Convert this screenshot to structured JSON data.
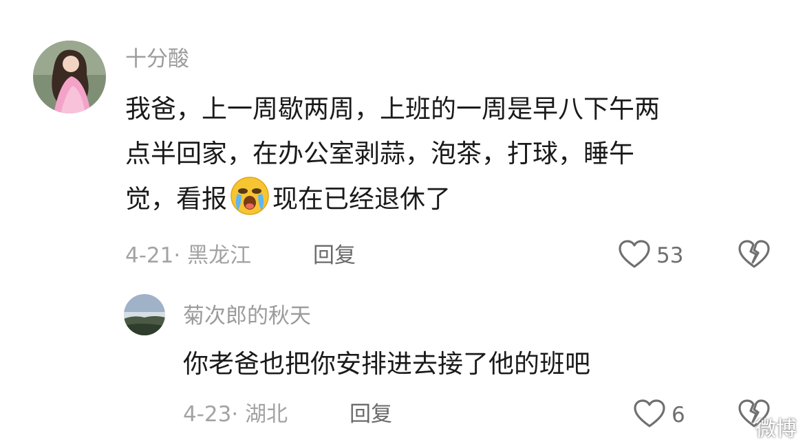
{
  "comments": [
    {
      "username": "十分酸",
      "content_lines": [
        "我爸，上一周歇两周，上班的一周是早八下午两",
        "点半回家，在办公室剥蒜，泡茶，打球，睡午",
        "觉，看报"
      ],
      "content_after_emoji": "现在已经退休了",
      "emoji_icon": "crying-face-icon",
      "date_location": "4-21· 黑龙江",
      "reply_label": "回复",
      "like_count": "53"
    },
    {
      "username": "菊次郎的秋天",
      "content": "你老爸也把你安排进去接了他的班吧",
      "date_location": "4-23· 湖北",
      "reply_label": "回复",
      "like_count": "6"
    }
  ],
  "watermark": "微博"
}
